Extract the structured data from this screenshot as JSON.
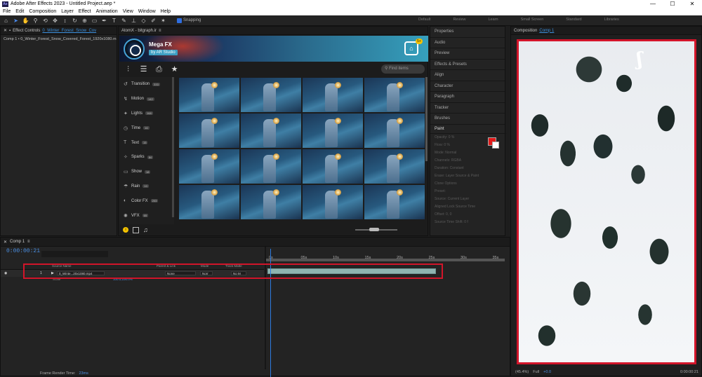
{
  "title_bar": {
    "app_badge": "Ae",
    "title": "Adobe After Effects 2023 - Untitled Project.aep *",
    "min": "—",
    "max": "☐",
    "close": "✕"
  },
  "menu": [
    "File",
    "Edit",
    "Composition",
    "Layer",
    "Effect",
    "Animation",
    "View",
    "Window",
    "Help"
  ],
  "toolbar": {
    "snapping": "Snapping",
    "workspaces": [
      "Default",
      "Review",
      "Learn",
      "Small Screen",
      "Standard",
      "Libraries"
    ]
  },
  "effect_controls": {
    "tab": "Effect Controls",
    "layer_link": "0_Winter_Forest_Snow_Cov",
    "row": "Comp 1 • 0_Winter_Forest_Snow_Covered_Forest_1920x1080.m"
  },
  "atomx": {
    "tab": "AtomX - bitgraph.ir",
    "banner_title": "Mega FX",
    "banner_by": "by AR Studio",
    "cart_count": "5+",
    "search_placeholder": "Find items",
    "categories": [
      {
        "label": "Transition",
        "count": "333"
      },
      {
        "label": "Motion",
        "count": "142"
      },
      {
        "label": "Lights",
        "count": "168"
      },
      {
        "label": "Time",
        "count": "16"
      },
      {
        "label": "Text",
        "count": "15"
      },
      {
        "label": "Sparks",
        "count": "84"
      },
      {
        "label": "Show",
        "count": "18"
      },
      {
        "label": "Rain",
        "count": "10"
      },
      {
        "label": "Color FX",
        "count": "203"
      },
      {
        "label": "VFX",
        "count": "65"
      }
    ],
    "thumbnail_count": 16
  },
  "right_panels": {
    "items": [
      "Properties",
      "Audio",
      "Preview",
      "Effects & Presets",
      "Align",
      "Character",
      "Paragraph",
      "Tracker",
      "Brushes"
    ],
    "paint": {
      "header": "Paint",
      "lines": [
        "Opacity: 0 %",
        "Flow: 0 %",
        "Mode: Normal",
        "Channels: RGBA",
        "Duration: Constant",
        "Erase: Layer Source & Paint",
        "Clone Options",
        "Preset:",
        "Source: Current Layer",
        "Aligned   Lock Source Time",
        "Offset: 0, 0",
        "Source Time Shift: 0 f"
      ],
      "fg_color": "#e21a1a",
      "bg_color": "#ffffff"
    }
  },
  "composition": {
    "tab": "Composition",
    "comp_link": "Comp 1",
    "zoom": "(45.4%)",
    "resolution": "Full",
    "exposure": "+0.0",
    "timecode": "0:00:00:21"
  },
  "timeline": {
    "tab": "Comp 1",
    "timecode": "0:00:00:21",
    "fps": "00021 (25.00 fps)",
    "columns": [
      "Source Name",
      "Parent & Link",
      "Mode",
      "Track Matte"
    ],
    "layer": {
      "index": "1",
      "name": "0_Winte...20x1080.mp4",
      "parent": "None",
      "mode": "Norr",
      "matte": "No M"
    },
    "scale_label": "Scale",
    "scale_value": "100.0,100.0%",
    "ruler": [
      "0s",
      "05s",
      "10s",
      "15s",
      "20s",
      "25s",
      "30s",
      "35s"
    ],
    "frame_render": "Frame Render Time:",
    "render_ms": "23ms"
  }
}
